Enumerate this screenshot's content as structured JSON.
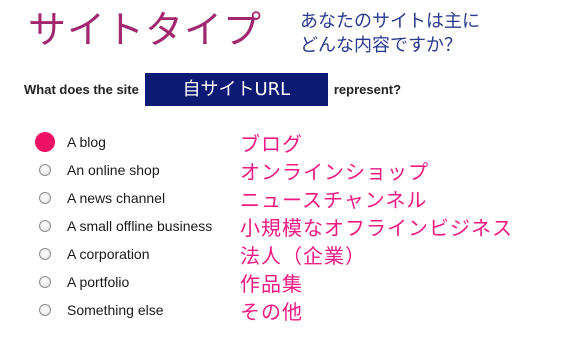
{
  "header": {
    "title_jp": "サイトタイプ",
    "subtitle_jp": "あなたのサイトは主に\nどんな内容ですか？"
  },
  "question": {
    "prefix": "What does the site",
    "url_placeholder": "自サイトURL",
    "suffix": "represent?"
  },
  "options": [
    {
      "label": "A blog",
      "label_jp": "ブログ",
      "selected": true
    },
    {
      "label": "An online shop",
      "label_jp": "オンラインショップ",
      "selected": false
    },
    {
      "label": "A news channel",
      "label_jp": "ニュースチャンネル",
      "selected": false
    },
    {
      "label": "A small offline business",
      "label_jp": "小規模なオフラインビジネス",
      "selected": false
    },
    {
      "label": "A corporation",
      "label_jp": "法人（企業）",
      "selected": false
    },
    {
      "label": "A portfolio",
      "label_jp": "作品集",
      "selected": false
    },
    {
      "label": "Something else",
      "label_jp": "その他",
      "selected": false
    }
  ],
  "colors": {
    "title": "#a1286f",
    "subtitle": "#2a3a8f",
    "url_box": "#0d1a73",
    "selected_radio": "#ee1166",
    "jp_option_text": "#ee1a84"
  },
  "icons": {
    "selected": "radio-selected-icon",
    "unselected": "radio-unselected-icon"
  }
}
